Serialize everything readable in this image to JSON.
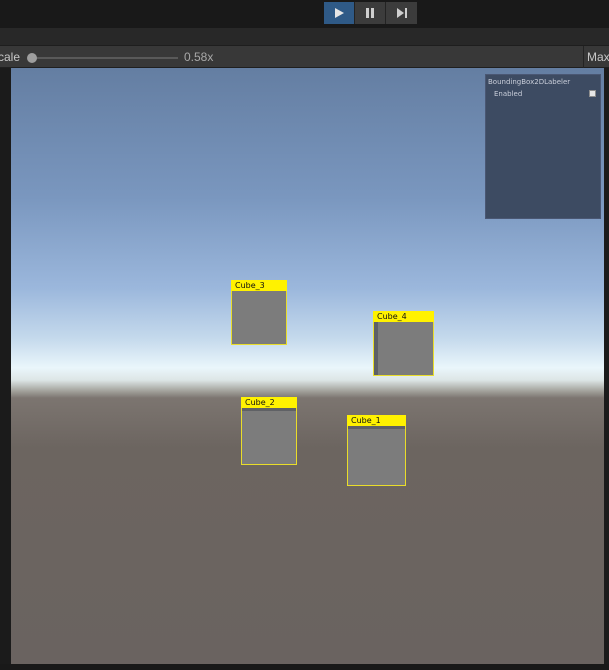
{
  "toolbar": {
    "play_icon": "play-icon",
    "pause_icon": "pause-icon",
    "step_icon": "step-icon",
    "accent_color": "#2f5a87"
  },
  "game_view": {
    "scale_label": "cale",
    "scale_value": "0.58x",
    "max_label": "Max"
  },
  "overlay_panel": {
    "title": "BoundingBox2DLabeler",
    "item_label": "Enabled",
    "item_checked": true
  },
  "objects": [
    {
      "label": "Cube_3"
    },
    {
      "label": "Cube_4"
    },
    {
      "label": "Cube_2"
    },
    {
      "label": "Cube_1"
    }
  ],
  "colors": {
    "bounding_box": "#fff200",
    "panel_bg": "#3d4b62"
  }
}
